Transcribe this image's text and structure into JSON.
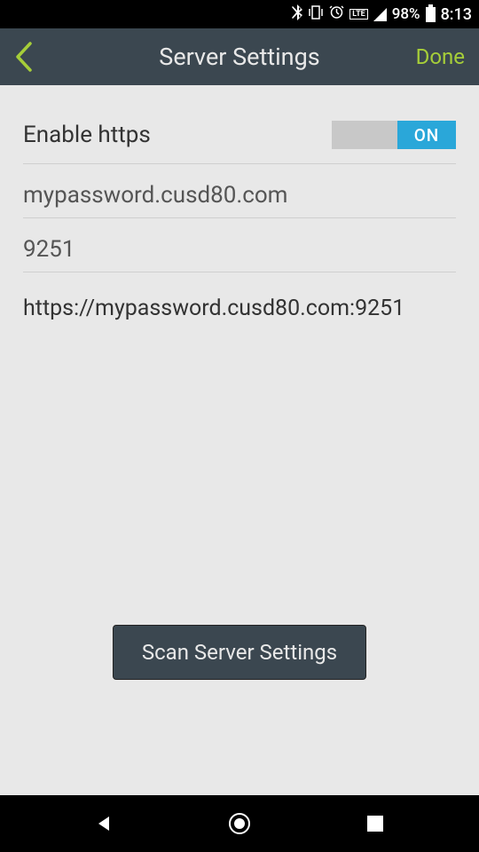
{
  "status": {
    "battery_text": "98%",
    "time": "8:13",
    "lte": "LTE"
  },
  "header": {
    "title": "Server Settings",
    "done_label": "Done"
  },
  "form": {
    "https_label": "Enable https",
    "toggle_on_label": "ON",
    "host_value": "mypassword.cusd80.com",
    "port_value": "9251",
    "url_display": "https://mypassword.cusd80.com:9251"
  },
  "actions": {
    "scan_label": "Scan Server Settings"
  }
}
